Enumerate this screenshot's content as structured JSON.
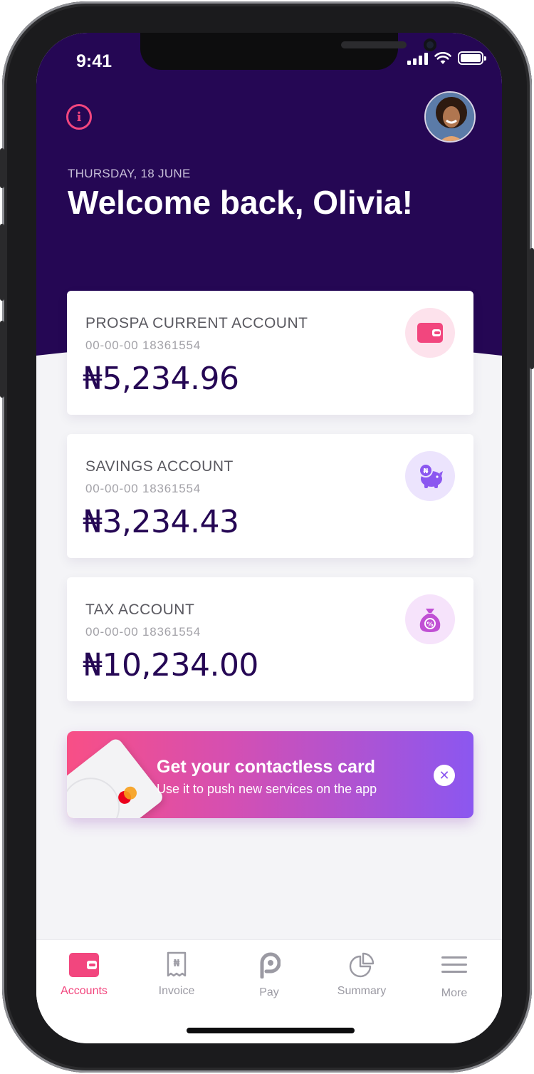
{
  "status_bar": {
    "time": "9:41"
  },
  "header": {
    "date": "THURSDAY, 18 JUNE",
    "welcome": "Welcome back, Olivia!"
  },
  "accounts": [
    {
      "name": "PROSPA CURRENT ACCOUNT",
      "number": "00-00-00 18361554",
      "amount": "₦5,234.96",
      "icon": "wallet-icon",
      "icon_bg": "#fde2ec",
      "icon_color": "#f2467e"
    },
    {
      "name": "SAVINGS ACCOUNT",
      "number": "00-00-00 18361554",
      "amount": "₦3,234.43",
      "icon": "piggy-bank-icon",
      "icon_bg": "#ece4fd",
      "icon_color": "#8b57f0"
    },
    {
      "name": "TAX ACCOUNT",
      "number": "00-00-00 18361554",
      "amount": "₦10,234.00",
      "icon": "tax-bag-icon",
      "icon_bg": "#f6e3fb",
      "icon_color": "#c04fd4"
    }
  ],
  "promo": {
    "title": "Get your contactless card",
    "subtitle": "Use it to push new services on the app"
  },
  "tabs": [
    {
      "label": "Accounts",
      "icon": "wallet-icon",
      "active": true
    },
    {
      "label": "Invoice",
      "icon": "invoice-icon",
      "active": false
    },
    {
      "label": "Pay",
      "icon": "pay-icon",
      "active": false
    },
    {
      "label": "Summary",
      "icon": "pie-chart-icon",
      "active": false
    },
    {
      "label": "More",
      "icon": "menu-icon",
      "active": false
    }
  ],
  "colors": {
    "header_bg": "#250754",
    "accent_pink": "#f2467e",
    "accent_purple": "#8b57f0",
    "amount_text": "#250754"
  }
}
